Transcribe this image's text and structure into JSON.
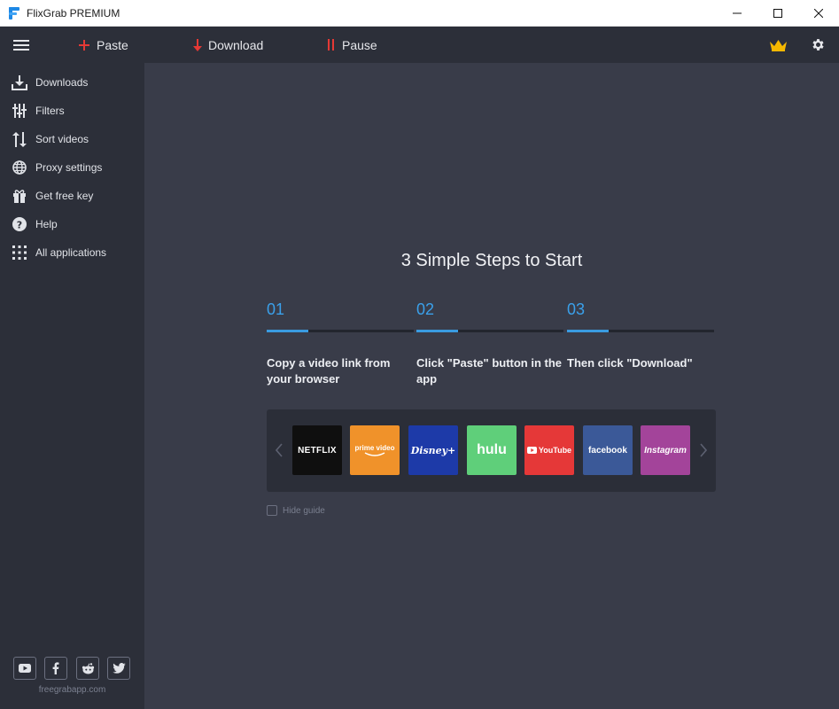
{
  "window": {
    "title": "FlixGrab PREMIUM"
  },
  "toolbar": {
    "paste_label": "Paste",
    "download_label": "Download",
    "pause_label": "Pause",
    "accent_red": "#e53935",
    "crown_color": "#f5b800"
  },
  "sidebar": {
    "items": [
      {
        "label": "Downloads",
        "icon": "download-icon"
      },
      {
        "label": "Filters",
        "icon": "filter-sliders-icon"
      },
      {
        "label": "Sort videos",
        "icon": "sort-icon"
      },
      {
        "label": "Proxy settings",
        "icon": "globe-icon"
      },
      {
        "label": "Get free key",
        "icon": "gift-icon"
      },
      {
        "label": "Help",
        "icon": "help-icon"
      },
      {
        "label": "All applications",
        "icon": "grid-icon"
      }
    ],
    "social": [
      "youtube-icon",
      "facebook-icon",
      "reddit-icon",
      "twitter-icon"
    ],
    "site": "freegrabapp.com"
  },
  "main": {
    "heading": "3 Simple Steps to Start",
    "steps": [
      {
        "num": "01",
        "text": "Copy a video link from your browser"
      },
      {
        "num": "02",
        "text": "Click \"Paste\" button in the app"
      },
      {
        "num": "03",
        "text": "Then click \"Download\""
      }
    ],
    "services": [
      {
        "label": "NETFLIX",
        "color": "#0f0f0f"
      },
      {
        "label": "prime video",
        "color": "#f0922a"
      },
      {
        "label": "Disney+",
        "color": "#1d3aa8"
      },
      {
        "label": "hulu",
        "color": "#5fcf7a"
      },
      {
        "label": "YouTube",
        "color": "#e53838"
      },
      {
        "label": "facebook",
        "color": "#3b5998"
      },
      {
        "label": "Instagram",
        "color": "#a3449a"
      }
    ],
    "hide_guide_label": "Hide guide",
    "accent_blue": "#3a9be0"
  }
}
